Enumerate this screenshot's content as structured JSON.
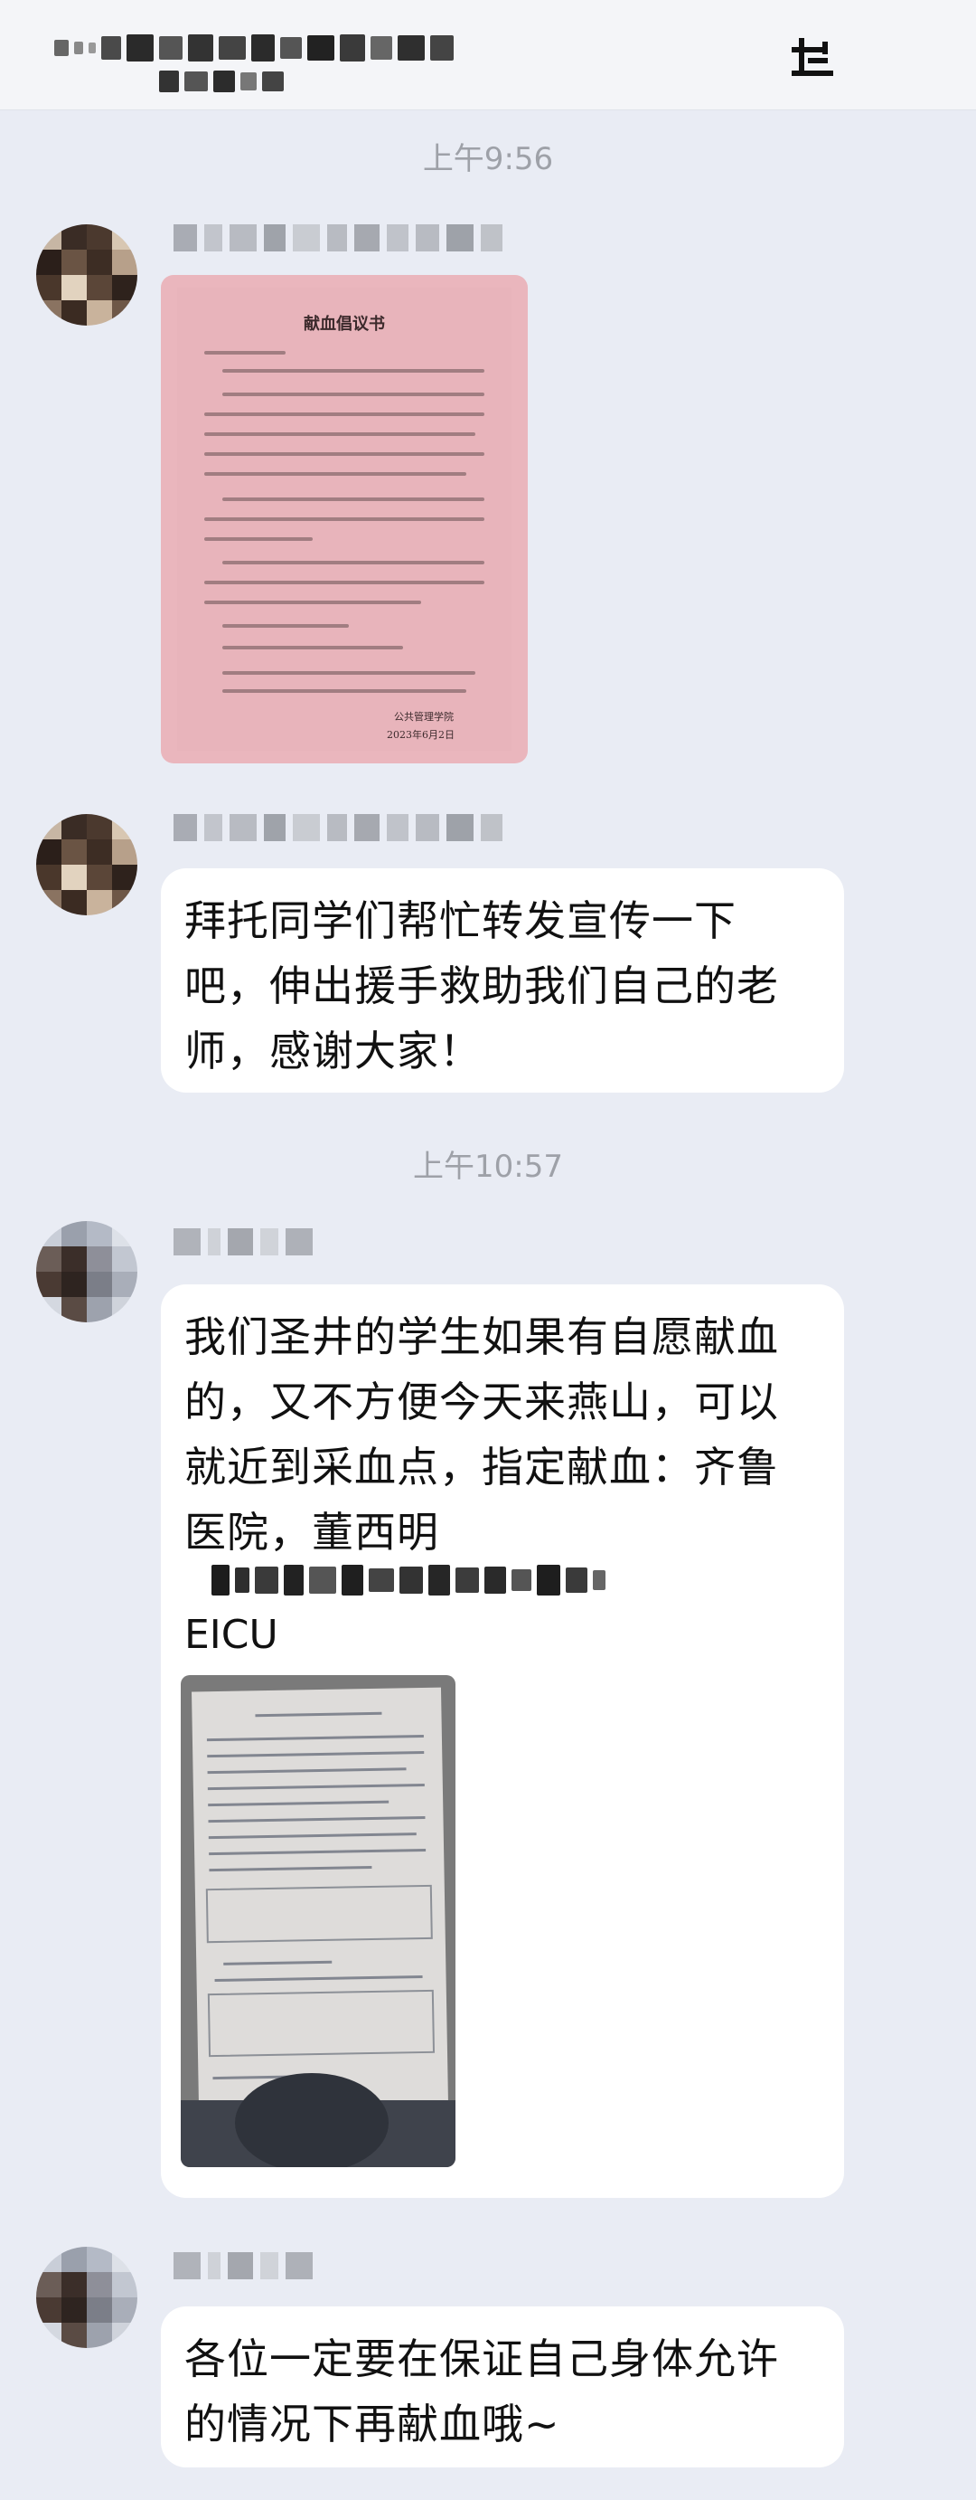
{
  "header": {
    "title_redacted": "redacted chat title",
    "icon": "add-member-icon"
  },
  "messages": [
    {
      "type": "time",
      "text": "上午9:56"
    },
    {
      "type": "image",
      "sender_redacted": true,
      "image_title": "献血倡议书",
      "image_footer_org": "公共管理学院",
      "image_footer_date": "2023年6月2日"
    },
    {
      "type": "text",
      "sender_redacted": true,
      "text": "拜托同学们帮忙转发宣传一下\n吧，伸出援手救助我们自己的老\n师，感谢大家！"
    },
    {
      "type": "time",
      "text": "上午10:57"
    },
    {
      "type": "text_image",
      "sender_redacted": true,
      "text": "我们圣井的学生如果有自愿献血\n的，又不方便今天来燕山，可以\n就近到采血点，指定献血：齐鲁\n医院，董西明",
      "text_after": "EICU",
      "image": "blood-donation-form-photo"
    },
    {
      "type": "text",
      "sender_redacted": true,
      "text": "各位一定要在保证自己身体允许\n的情况下再献血哦~"
    }
  ],
  "colors": {
    "background": "#e9ecf4",
    "bubble": "#ffffff",
    "timestamp": "#9ea1a8",
    "letter_pink": "#e8b4bb"
  }
}
